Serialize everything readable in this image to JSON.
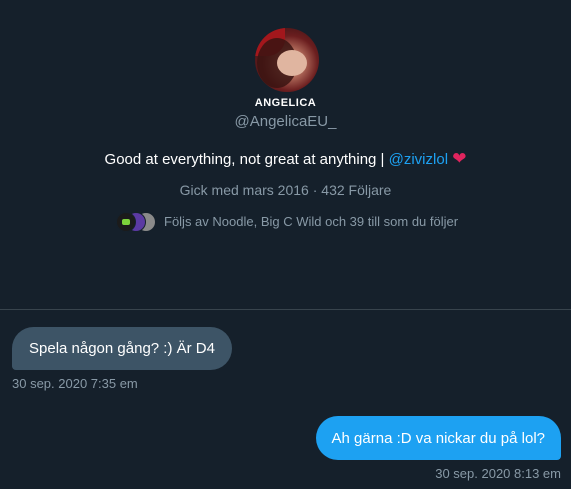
{
  "profile": {
    "display_name": "ANGELICA",
    "handle": "@AngelicaEU_",
    "bio_text": "Good at everything, not great at anything | ",
    "bio_mention": "@zivizlol",
    "bio_emoji": "❤",
    "joined": "Gick med mars 2016",
    "separator": " · ",
    "followers": "432 Följare",
    "followed_by": "Följs av Noodle, Big C Wild och 39 till som du följer"
  },
  "messages": [
    {
      "direction": "received",
      "text": "Spela någon gång? :) Är D4",
      "timestamp": "30 sep. 2020 7:35 em"
    },
    {
      "direction": "sent",
      "text": "Ah gärna :D va nickar du på lol?",
      "timestamp": "30 sep. 2020 8:13 em"
    }
  ],
  "colors": {
    "background": "#15202b",
    "received_bubble": "#3d5466",
    "sent_bubble": "#1da1f2",
    "muted_text": "#8899a6",
    "mention": "#1da1f2",
    "heart": "#e0245e"
  }
}
